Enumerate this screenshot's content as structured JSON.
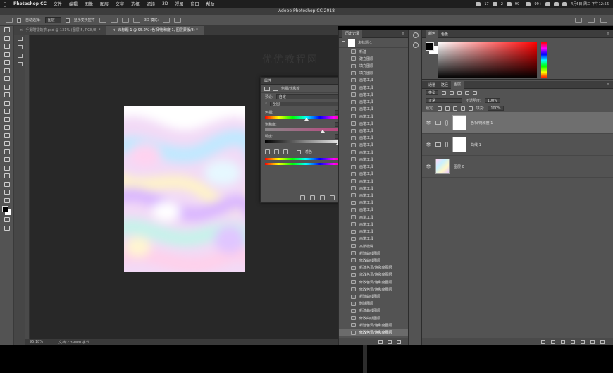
{
  "menubar": {
    "app": "Photoshop CC",
    "items": [
      "文件",
      "编辑",
      "图像",
      "图层",
      "文字",
      "选择",
      "滤镜",
      "3D",
      "视图",
      "窗口",
      "帮助"
    ],
    "status_items": [
      "17",
      "2",
      "99+",
      "99+"
    ],
    "datetime": "4月6日 周二 下午12:56"
  },
  "window_title": "Adobe Photoshop CC 2018",
  "options": {
    "auto_select_label": "自动选择:",
    "auto_select_value": "图层",
    "show_transform_label": "显示变换控件",
    "mode_label": "3D 模式:"
  },
  "tabs": [
    {
      "label": "手摄瞄镭奶茶.psd @ 131% (图层 5, RGB/8) *",
      "active": false
    },
    {
      "label": "未标题-1 @ 95.2% (色相/饱和度 1, 图层蒙版/8) *",
      "active": true
    }
  ],
  "watermark": "优优教程网",
  "statusbar": {
    "zoom": "95.18%",
    "doc": "文档:2.39M/0 字节"
  },
  "properties": {
    "title": "属性",
    "subtitle": "色相/饱和度",
    "preset_label": "预设:",
    "preset_value": "自定",
    "channel_value": "全图",
    "hue_label": "色相:",
    "hue_value": "0",
    "hue_level": 0.5,
    "sat_label": "饱和度:",
    "sat_value": "+40",
    "sat_level": 0.7,
    "light_label": "明度:",
    "light_value": "+78",
    "light_level": 0.89,
    "colorize_label": "着色"
  },
  "history": {
    "title": "历史记录",
    "snapshot": "未标题-1",
    "items": [
      "新建",
      "建立图层",
      "填充图层",
      "填充图层",
      "画笔工具",
      "画笔工具",
      "画笔工具",
      "画笔工具",
      "画笔工具",
      "画笔工具",
      "画笔工具",
      "画笔工具",
      "画笔工具",
      "画笔工具",
      "画笔工具",
      "画笔工具",
      "画笔工具",
      "画笔工具",
      "画笔工具",
      "画笔工具",
      "画笔工具",
      "画笔工具",
      "画笔工具",
      "画笔工具",
      "画笔工具",
      "画笔工具",
      "画笔工具",
      "高斯模糊",
      "新建曲线图层",
      "修改曲线图层",
      "新建色调/饱和度图层",
      "修改色调/饱和度图层",
      "修改色调/饱和度图层",
      "修改色调/饱和度图层",
      "新建曲线图层",
      "删除图层",
      "新建曲线图层",
      "修改曲线图层",
      "新建色调/饱和度图层",
      "修改色调/饱和度图层"
    ],
    "selected_index": 39
  },
  "color_panel": {
    "tabs": [
      "颜色",
      "色板"
    ]
  },
  "layers_panel": {
    "tabs": [
      "通道",
      "路径",
      "图层"
    ],
    "kind_label": "类型",
    "blend_mode": "正常",
    "opacity_label": "不透明度:",
    "opacity_value": "100%",
    "lock_label": "锁定:",
    "fill_label": "填充:",
    "fill_value": "100%",
    "layers": [
      {
        "name": "色相/饱和度 1",
        "selected": true
      },
      {
        "name": "曲线 1",
        "selected": false
      },
      {
        "name": "图层 0",
        "selected": false
      }
    ]
  }
}
